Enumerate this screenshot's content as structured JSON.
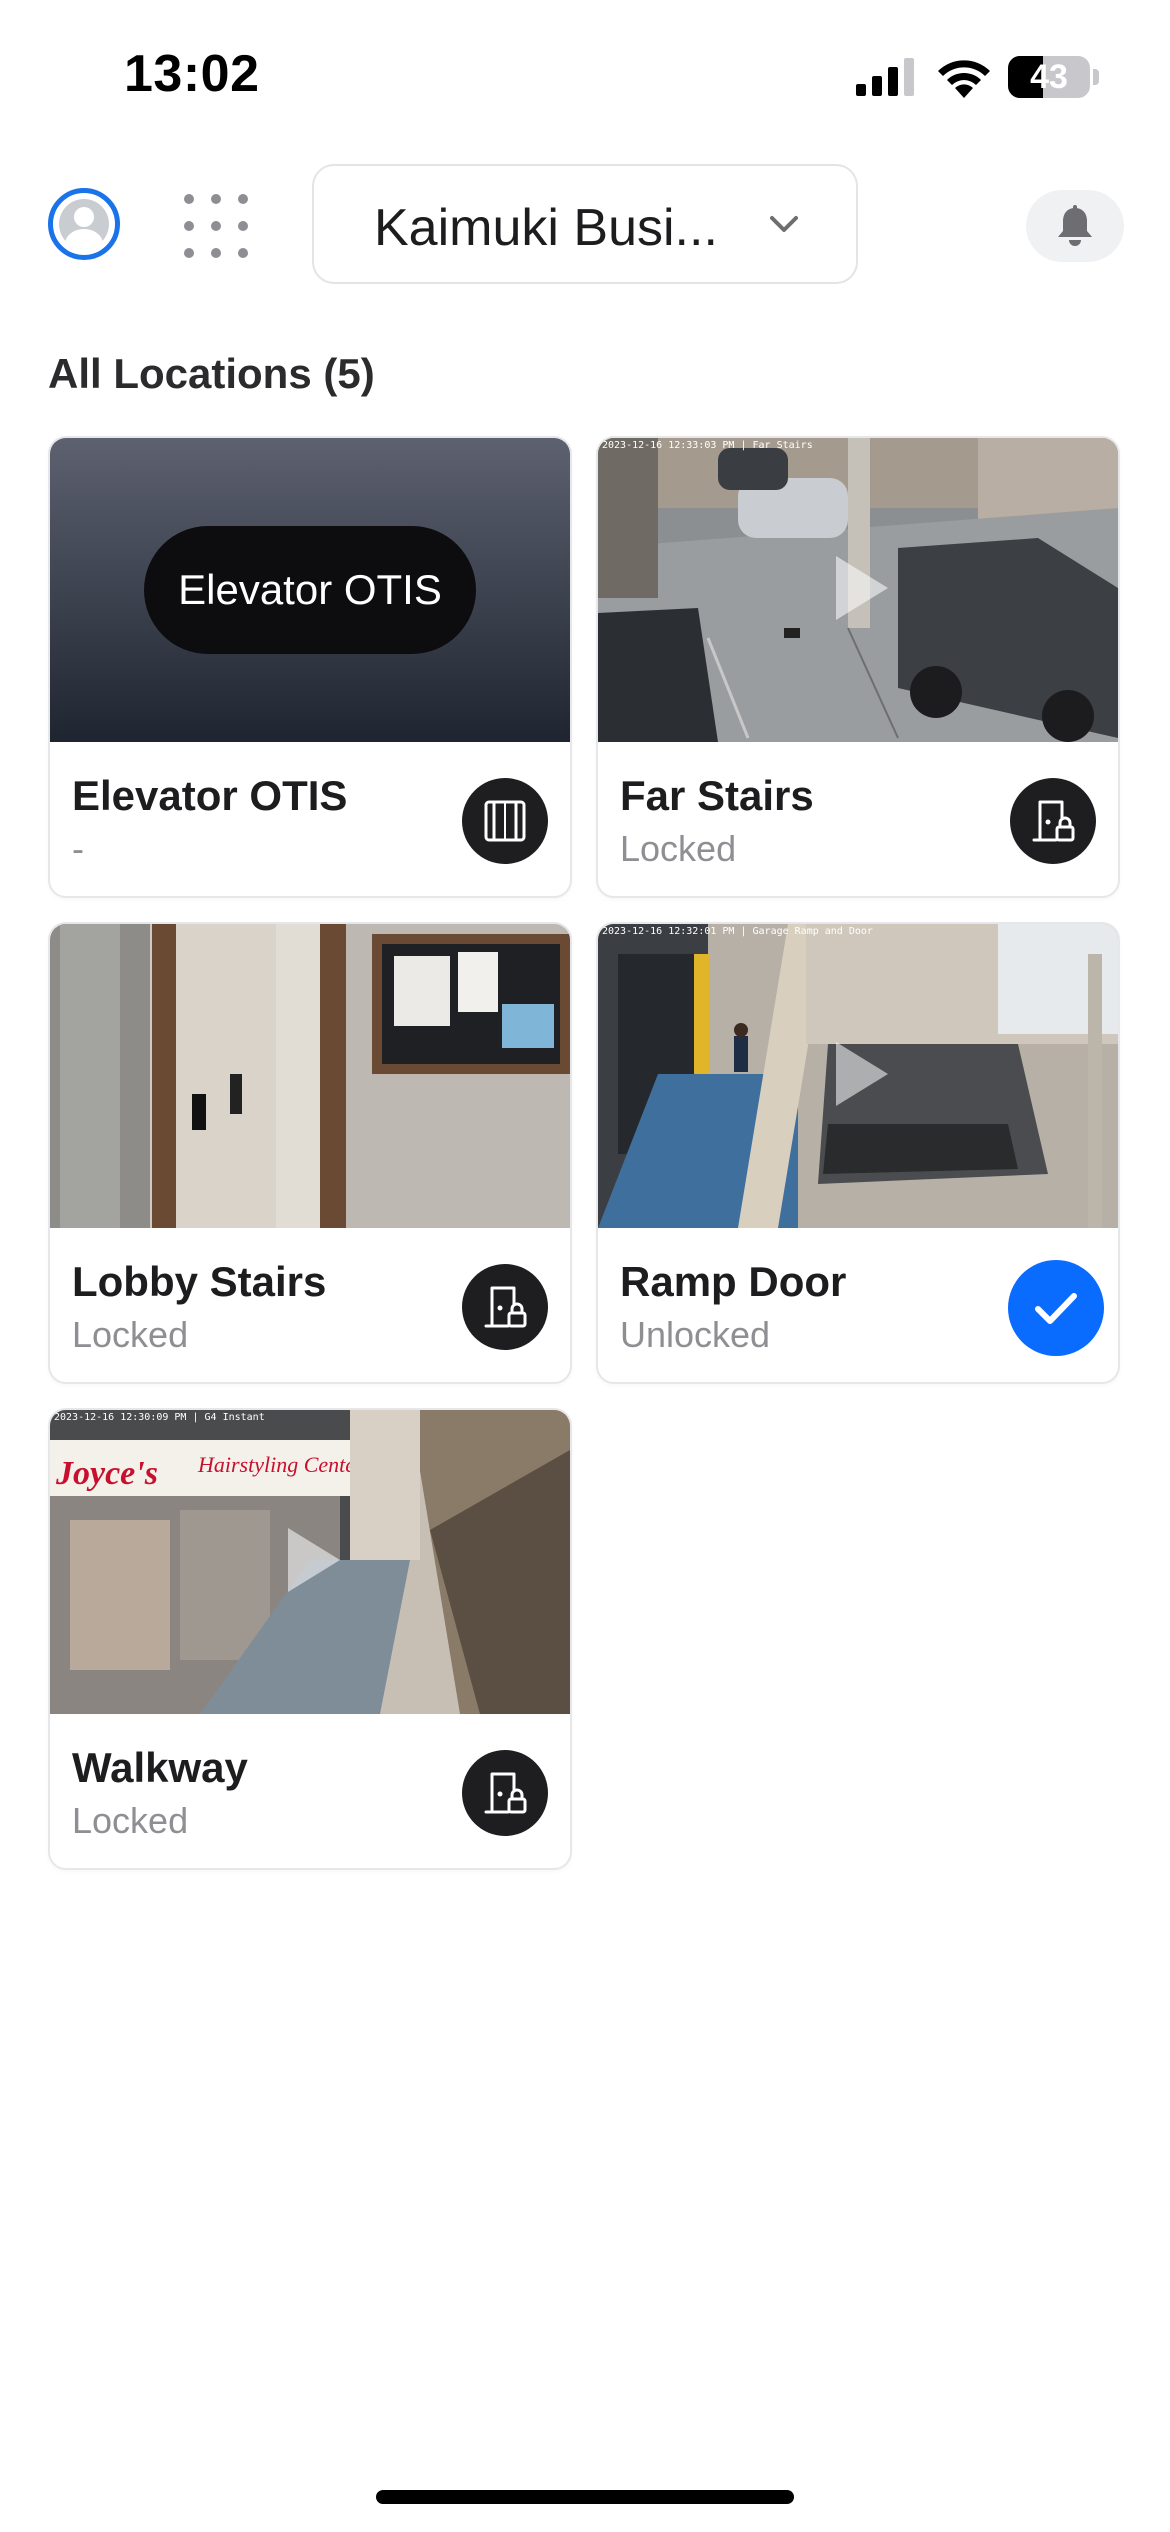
{
  "status_bar": {
    "time": "13:02",
    "battery": "43",
    "battery_level": 0.43
  },
  "header": {
    "site_name": "Kaimuki Busi...",
    "icons": [
      "avatar",
      "apps-grid-icon",
      "chevron-down-icon",
      "bell-icon"
    ]
  },
  "section": {
    "title": "All Locations (5)"
  },
  "cards": [
    {
      "name": "Elevator OTIS",
      "status": "-",
      "thumb_label": "Elevator OTIS",
      "action_icon": "elevator-icon"
    },
    {
      "name": "Far Stairs",
      "status": "Locked",
      "timestamp": "2023-12-16 12:33:03 PM | Far Stairs",
      "action_icon": "door-lock-icon"
    },
    {
      "name": "Lobby Stairs",
      "status": "Locked",
      "action_icon": "door-lock-icon"
    },
    {
      "name": "Ramp Door",
      "status": "Unlocked",
      "timestamp": "2023-12-16 12:32:01 PM | Garage Ramp and Door",
      "action_icon": "check-icon"
    },
    {
      "name": "Walkway",
      "status": "Locked",
      "timestamp": "2023-12-16 12:30:09 PM | G4 Instant",
      "sign_text": "Joyce's Hairstyling Center",
      "action_icon": "door-lock-icon"
    }
  ],
  "colors": {
    "accent": "#0a6cff",
    "avatar_ring": "#1a73e8",
    "dark_button": "#1e1e20",
    "muted_text": "#8e8e93"
  }
}
